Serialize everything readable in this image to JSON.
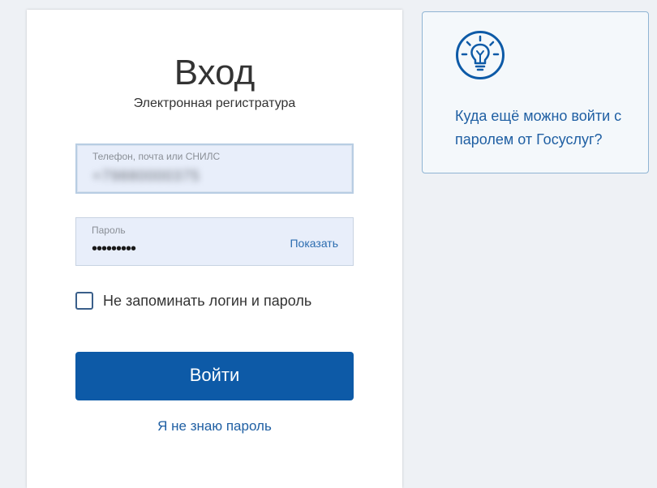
{
  "login": {
    "title": "Вход",
    "subtitle": "Электронная регистратура",
    "login_field": {
      "label": "Телефон, почта или СНИЛС",
      "value": "+79880000375"
    },
    "password_field": {
      "label": "Пароль",
      "value": "•••••••••",
      "show_label": "Показать"
    },
    "remember": {
      "label": "Не запоминать логин и пароль",
      "checked": false
    },
    "submit_label": "Войти",
    "forgot_label": "Я не знаю пароль"
  },
  "info": {
    "icon": "lightbulb-icon",
    "text": "Куда ещё можно войти с паролем от Госуслуг?"
  },
  "colors": {
    "accent": "#0d5aa7",
    "link": "#1f5fa3",
    "field_bg": "#e8eefa",
    "page_bg": "#eef1f5"
  }
}
